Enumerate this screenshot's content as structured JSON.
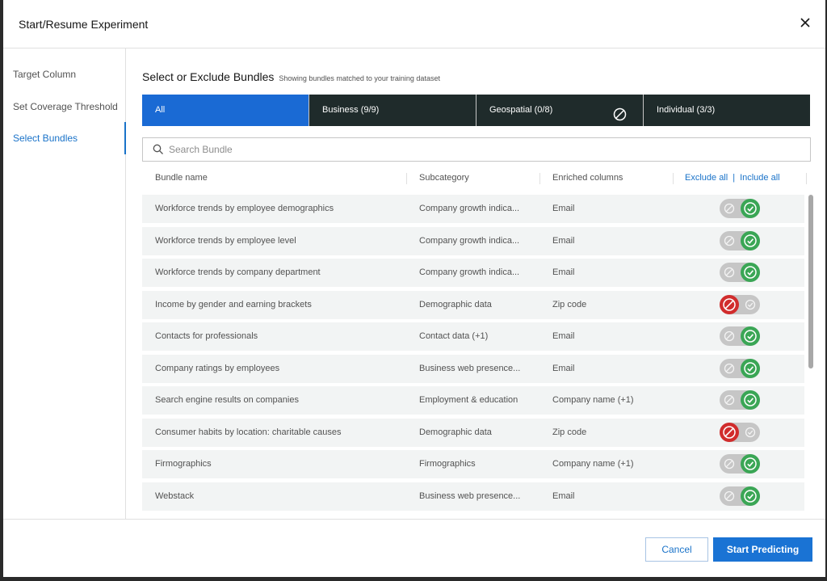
{
  "modal": {
    "title": "Start/Resume Experiment"
  },
  "sidebar": {
    "items": [
      {
        "label": "Target Column"
      },
      {
        "label": "Set Coverage Threshold"
      },
      {
        "label": "Select Bundles"
      }
    ],
    "active_index": 2
  },
  "section": {
    "title": "Select or Exclude Bundles",
    "subtitle": "Showing bundles matched to your training dataset"
  },
  "tabs": [
    {
      "label": "All"
    },
    {
      "label": "Business (9/9)"
    },
    {
      "label": "Geospatial (0/8)"
    },
    {
      "label": "Individual (3/3)"
    }
  ],
  "search": {
    "placeholder": "Search Bundle",
    "value": ""
  },
  "table": {
    "columns": {
      "name": "Bundle name",
      "subcategory": "Subcategory",
      "enriched": "Enriched columns"
    },
    "exclude_all": "Exclude all",
    "separator": "|",
    "include_all": "Include all",
    "rows": [
      {
        "name": "Workforce trends by employee demographics",
        "subcategory": "Company growth indica...",
        "enriched": "Email",
        "state": "included"
      },
      {
        "name": "Workforce trends by employee level",
        "subcategory": "Company growth indica...",
        "enriched": "Email",
        "state": "included"
      },
      {
        "name": "Workforce trends by company department",
        "subcategory": "Company growth indica...",
        "enriched": "Email",
        "state": "included"
      },
      {
        "name": "Income by gender and earning brackets",
        "subcategory": "Demographic data",
        "enriched": "Zip code",
        "state": "excluded"
      },
      {
        "name": "Contacts for professionals",
        "subcategory": "Contact data (+1)",
        "enriched": "Email",
        "state": "included"
      },
      {
        "name": "Company ratings by employees",
        "subcategory": "Business web presence...",
        "enriched": "Email",
        "state": "included"
      },
      {
        "name": "Search engine results on companies",
        "subcategory": "Employment & education",
        "enriched": "Company name (+1)",
        "state": "included"
      },
      {
        "name": "Consumer habits by location: charitable causes",
        "subcategory": "Demographic data",
        "enriched": "Zip code",
        "state": "excluded"
      },
      {
        "name": "Firmographics",
        "subcategory": "Firmographics",
        "enriched": "Company name (+1)",
        "state": "included"
      },
      {
        "name": "Webstack",
        "subcategory": "Business web presence...",
        "enriched": "Email",
        "state": "included"
      }
    ]
  },
  "footer": {
    "cancel_label": "Cancel",
    "primary_label": "Start Predicting"
  },
  "colors": {
    "accent": "#1a73d4",
    "tab_bar": "#1f2b2b",
    "included": "#3aa655",
    "excluded": "#d12c2c",
    "toggle_off": "#c6c6c6"
  }
}
